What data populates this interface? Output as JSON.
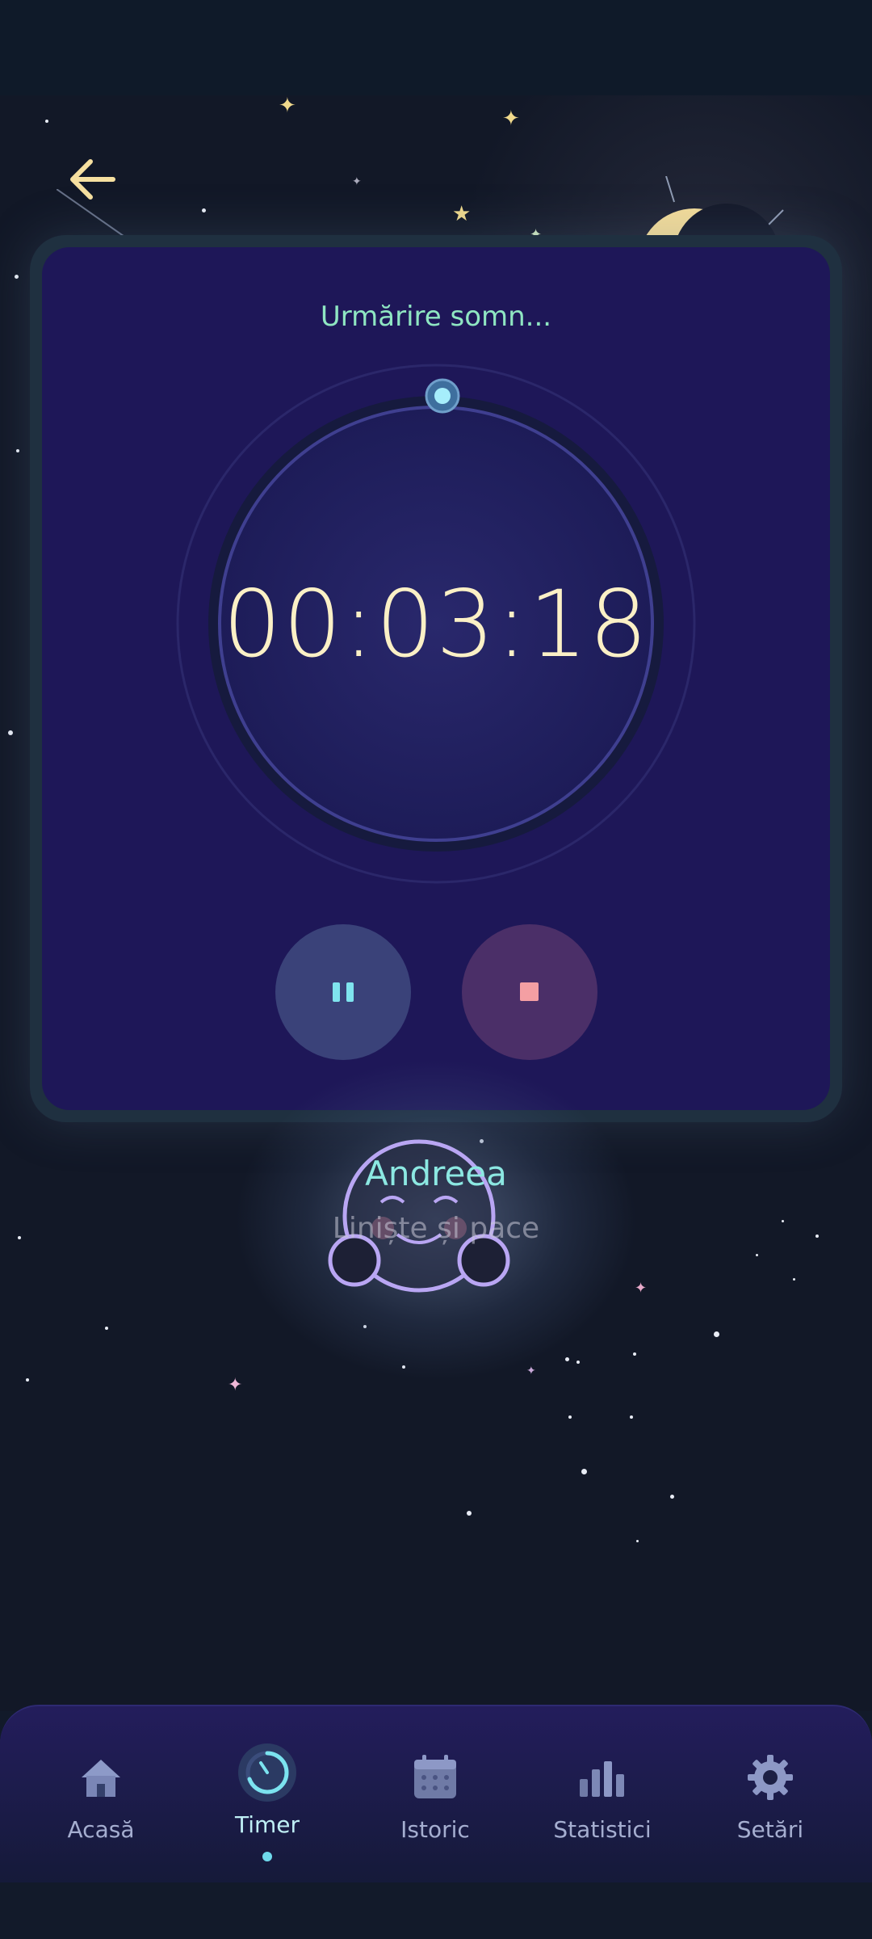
{
  "header": {
    "back_icon": "arrow-left-icon"
  },
  "session": {
    "status_text": "Urmărire somn...",
    "elapsed": "00:03:18"
  },
  "controls": {
    "pause_icon": "pause-icon",
    "stop_icon": "stop-icon"
  },
  "profile": {
    "name": "Andreea",
    "subtitle": "Liniște și pace"
  },
  "nav": {
    "items": [
      {
        "label": "Acasă",
        "icon": "home-icon"
      },
      {
        "label": "Timer",
        "icon": "timer-icon",
        "active": true
      },
      {
        "label": "Istoric",
        "icon": "calendar-icon"
      },
      {
        "label": "Statistici",
        "icon": "bar-chart-icon"
      },
      {
        "label": "Setări",
        "icon": "gear-icon"
      }
    ]
  },
  "colors": {
    "panel_bg": "#1e1758",
    "accent_green": "#8fe6c2",
    "timer_text": "#fbf0c6",
    "pause_btn": "#3a4279",
    "stop_btn": "#4b2f68",
    "active_nav": "#6fd9ec"
  }
}
